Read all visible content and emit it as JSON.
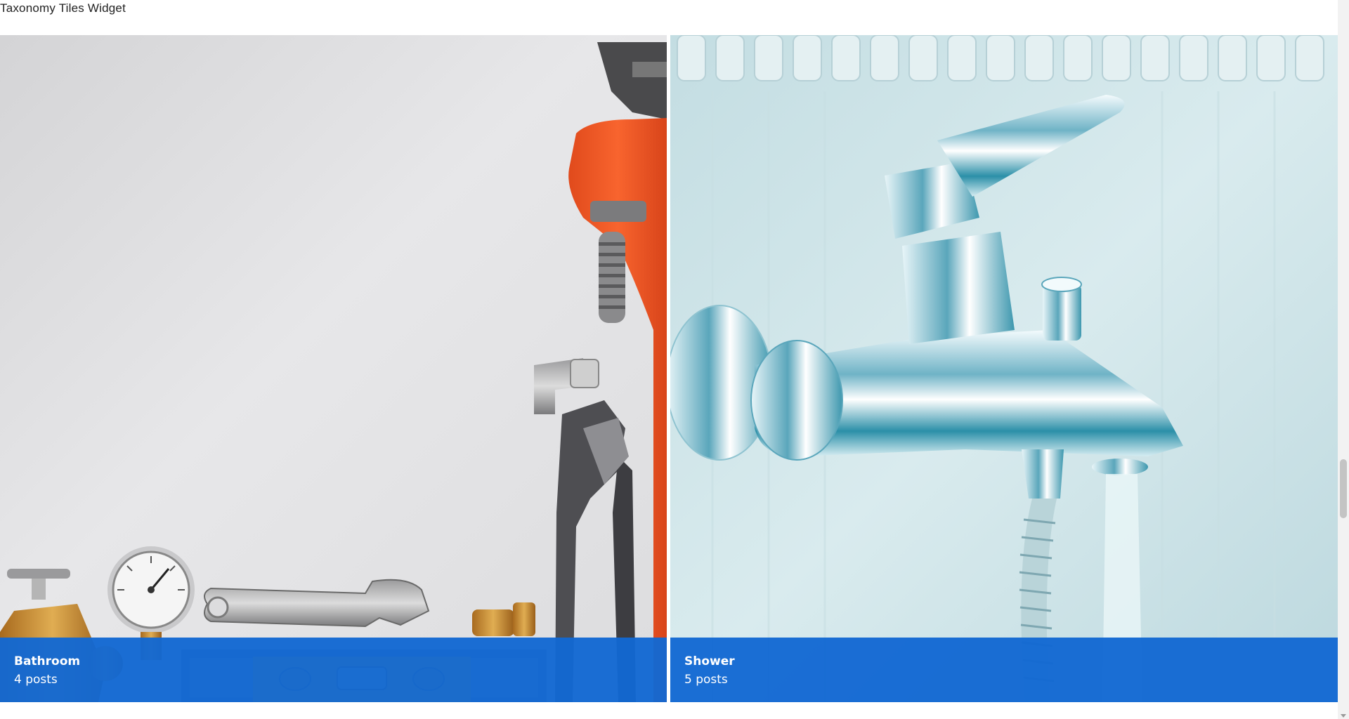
{
  "widget": {
    "title": "Taxonomy Tiles Widget"
  },
  "tiles": [
    {
      "name": "Bathroom",
      "count": "4 posts",
      "image": "plumbing-tools-image"
    },
    {
      "name": "Shower",
      "count": "5 posts",
      "image": "chrome-faucet-image"
    }
  ],
  "colors": {
    "overlay": "#1268d2",
    "wrench_orange": "#f05a28",
    "brass": "#c8932f"
  }
}
